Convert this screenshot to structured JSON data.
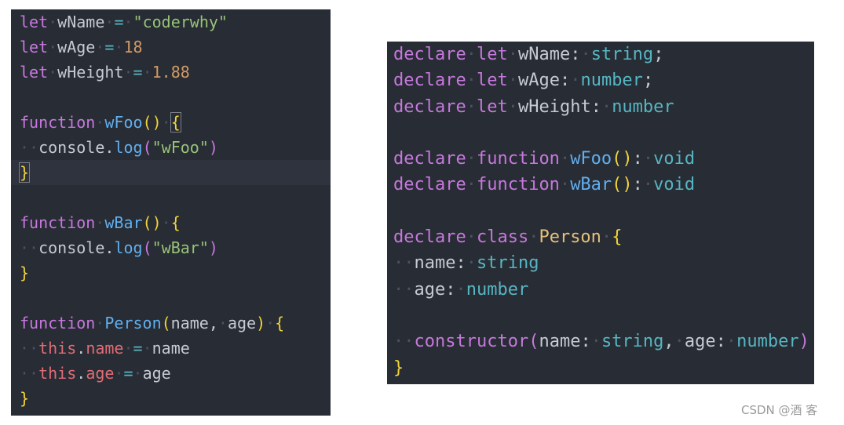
{
  "left_editor": {
    "language": "javascript",
    "current_line": 6,
    "lines": [
      [
        [
          "let",
          "kw"
        ],
        " ",
        [
          "wName",
          "var"
        ],
        " ",
        [
          "=",
          "op"
        ],
        " ",
        [
          "\"coderwhy\"",
          "str"
        ]
      ],
      [
        [
          "let",
          "kw"
        ],
        " ",
        [
          "wAge",
          "var"
        ],
        " ",
        [
          "=",
          "op"
        ],
        " ",
        [
          "18",
          "num"
        ]
      ],
      [
        [
          "let",
          "kw"
        ],
        " ",
        [
          "wHeight",
          "var"
        ],
        " ",
        [
          "=",
          "op"
        ],
        " ",
        [
          "1.88",
          "num"
        ]
      ],
      [],
      [
        [
          "function",
          "kw"
        ],
        " ",
        [
          "wFoo",
          "fn"
        ],
        [
          "()",
          "paren"
        ],
        " ",
        [
          "{",
          "paren",
          "match"
        ]
      ],
      [
        "  ",
        [
          "console",
          "var"
        ],
        [
          ".",
          "punc"
        ],
        [
          "log",
          "fn"
        ],
        [
          "(",
          "pparen"
        ],
        [
          "\"wFoo\"",
          "str"
        ],
        [
          ")",
          "pparen"
        ]
      ],
      [
        [
          "}",
          "paren",
          "match"
        ]
      ],
      [],
      [
        [
          "function",
          "kw"
        ],
        " ",
        [
          "wBar",
          "fn"
        ],
        [
          "()",
          "paren"
        ],
        " ",
        [
          "{",
          "paren"
        ]
      ],
      [
        "  ",
        [
          "console",
          "var"
        ],
        [
          ".",
          "punc"
        ],
        [
          "log",
          "fn"
        ],
        [
          "(",
          "pparen"
        ],
        [
          "\"wBar\"",
          "str"
        ],
        [
          ")",
          "pparen"
        ]
      ],
      [
        [
          "}",
          "paren"
        ]
      ],
      [],
      [
        [
          "function",
          "kw"
        ],
        " ",
        [
          "Person",
          "fn"
        ],
        [
          "(",
          "paren"
        ],
        [
          "name",
          "var"
        ],
        [
          ",",
          "punc"
        ],
        " ",
        [
          "age",
          "var"
        ],
        [
          ")",
          "paren"
        ],
        " ",
        [
          "{",
          "paren"
        ]
      ],
      [
        "  ",
        [
          "this",
          "prop"
        ],
        [
          ".",
          "punc"
        ],
        [
          "name",
          "prop"
        ],
        " ",
        [
          "=",
          "op"
        ],
        " ",
        [
          "name",
          "var"
        ]
      ],
      [
        "  ",
        [
          "this",
          "prop"
        ],
        [
          ".",
          "punc"
        ],
        [
          "age",
          "prop"
        ],
        " ",
        [
          "=",
          "op"
        ],
        " ",
        [
          "age",
          "var"
        ]
      ],
      [
        [
          "}",
          "paren"
        ]
      ]
    ]
  },
  "right_editor": {
    "language": "typescript",
    "lines": [
      [
        [
          "declare",
          "kw"
        ],
        " ",
        [
          "let",
          "kw"
        ],
        " ",
        [
          "wName",
          "var"
        ],
        [
          ":",
          "punc"
        ],
        " ",
        [
          "string",
          "type"
        ],
        [
          ";",
          "punc"
        ]
      ],
      [
        [
          "declare",
          "kw"
        ],
        " ",
        [
          "let",
          "kw"
        ],
        " ",
        [
          "wAge",
          "var"
        ],
        [
          ":",
          "punc"
        ],
        " ",
        [
          "number",
          "type"
        ],
        [
          ";",
          "punc"
        ]
      ],
      [
        [
          "declare",
          "kw"
        ],
        " ",
        [
          "let",
          "kw"
        ],
        " ",
        [
          "wHeight",
          "var"
        ],
        [
          ":",
          "punc"
        ],
        " ",
        [
          "number",
          "type"
        ]
      ],
      [],
      [
        [
          "declare",
          "kw"
        ],
        " ",
        [
          "function",
          "kw"
        ],
        " ",
        [
          "wFoo",
          "fn"
        ],
        [
          "()",
          "paren"
        ],
        [
          ":",
          "punc"
        ],
        " ",
        [
          "void",
          "type"
        ]
      ],
      [
        [
          "declare",
          "kw"
        ],
        " ",
        [
          "function",
          "kw"
        ],
        " ",
        [
          "wBar",
          "fn"
        ],
        [
          "()",
          "paren"
        ],
        [
          ":",
          "punc"
        ],
        " ",
        [
          "void",
          "type"
        ]
      ],
      [],
      [
        [
          "declare",
          "kw"
        ],
        " ",
        [
          "class",
          "kw"
        ],
        " ",
        [
          "Person",
          "cls"
        ],
        " ",
        [
          "{",
          "paren"
        ]
      ],
      [
        "  ",
        [
          "name",
          "var"
        ],
        [
          ":",
          "punc"
        ],
        " ",
        [
          "string",
          "type"
        ]
      ],
      [
        "  ",
        [
          "age",
          "var"
        ],
        [
          ":",
          "punc"
        ],
        " ",
        [
          "number",
          "type"
        ]
      ],
      [],
      [
        "  ",
        [
          "constructor",
          "kw"
        ],
        [
          "(",
          "pparen"
        ],
        [
          "name",
          "var"
        ],
        [
          ":",
          "punc"
        ],
        " ",
        [
          "string",
          "type"
        ],
        [
          ",",
          "punc"
        ],
        " ",
        [
          "age",
          "var"
        ],
        [
          ":",
          "punc"
        ],
        " ",
        [
          "number",
          "type"
        ],
        [
          ")",
          "pparen"
        ]
      ],
      [
        [
          "}",
          "paren"
        ]
      ]
    ]
  },
  "watermark": "CSDN @酒 客"
}
